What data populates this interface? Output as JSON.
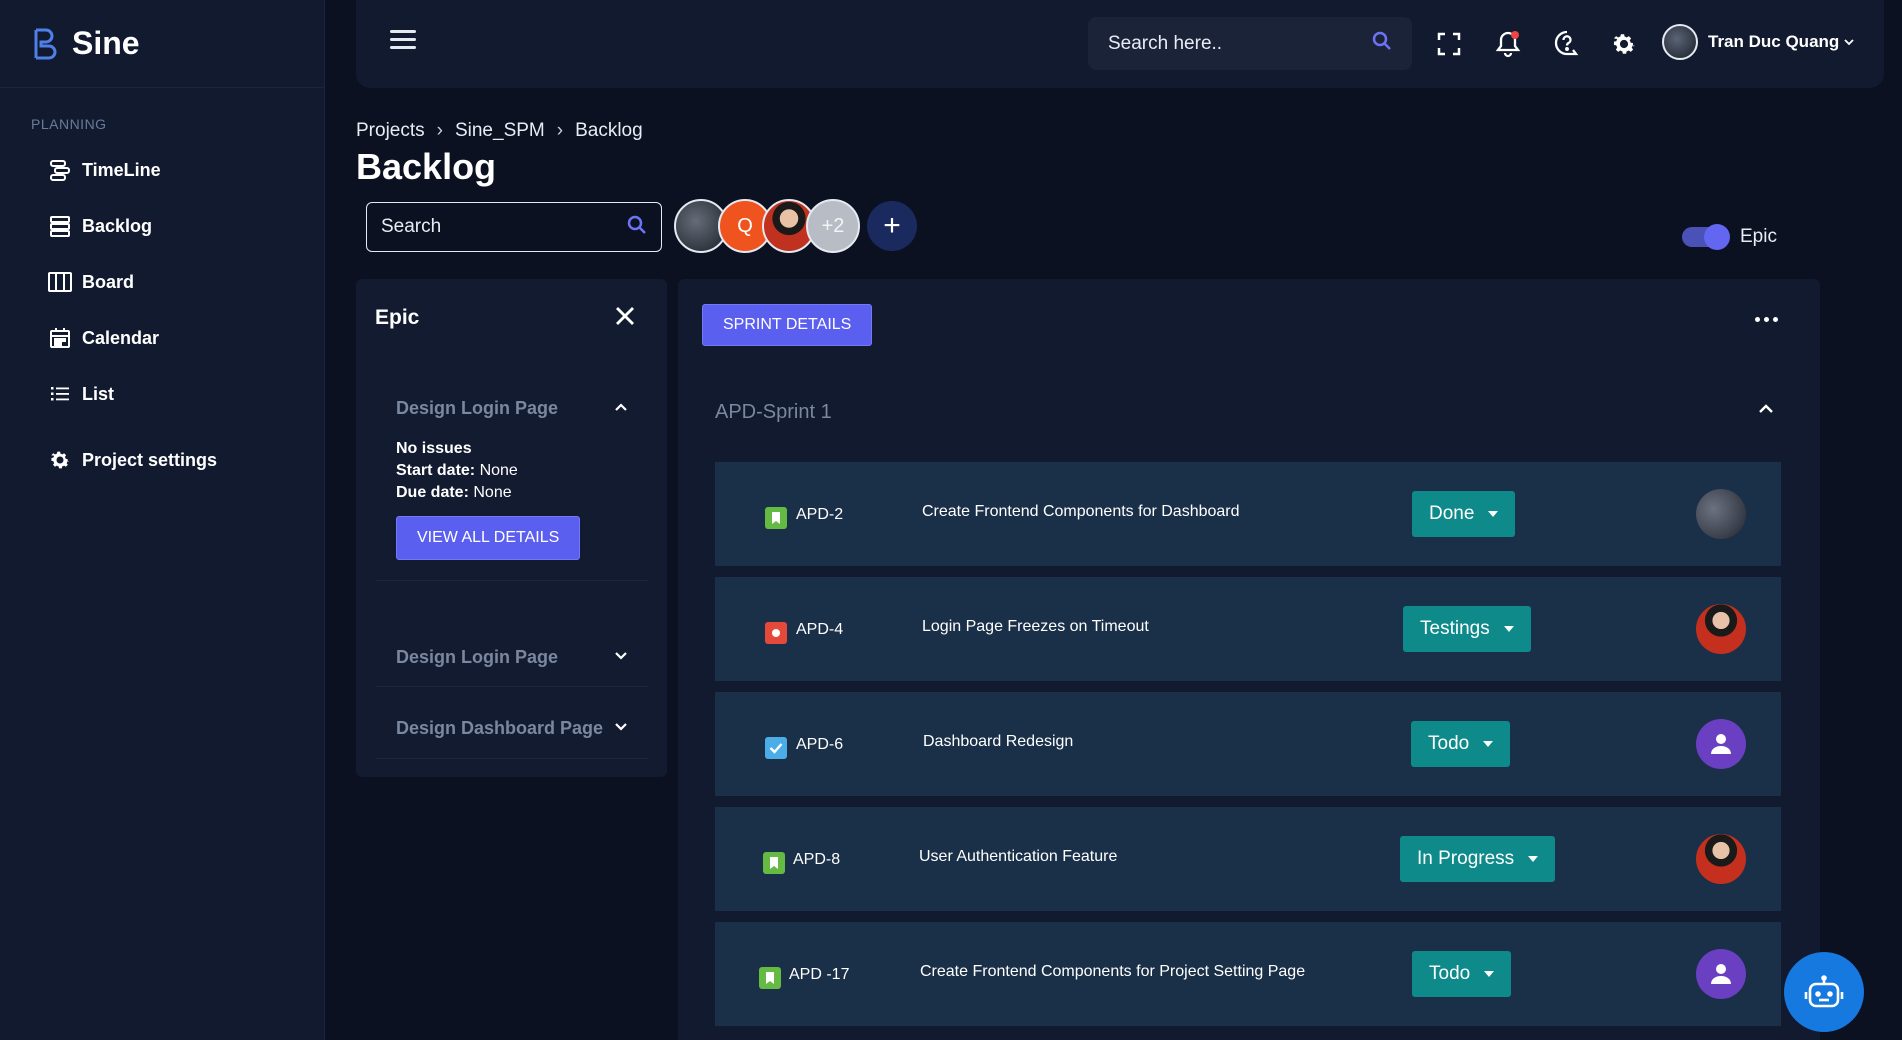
{
  "app": {
    "name": "Sine"
  },
  "sidebar": {
    "section": "PLANNING",
    "items": [
      {
        "label": "TimeLine",
        "icon": "timeline-icon"
      },
      {
        "label": "Backlog",
        "icon": "backlog-icon"
      },
      {
        "label": "Board",
        "icon": "board-icon"
      },
      {
        "label": "Calendar",
        "icon": "calendar-icon"
      },
      {
        "label": "List",
        "icon": "list-icon"
      }
    ],
    "settings": {
      "label": "Project settings",
      "icon": "gear-icon"
    }
  },
  "header": {
    "search_placeholder": "Search here..",
    "user_name": "Tran Duc Quang",
    "notification_dot_color": "#ef4444"
  },
  "breadcrumb": [
    "Projects",
    "Sine_SPM",
    "Backlog"
  ],
  "page_title": "Backlog",
  "backlog_search_placeholder": "Search",
  "members": {
    "initial": "Q",
    "extra": "+2",
    "add": "+"
  },
  "epic_toggle": {
    "label": "Epic",
    "on": true
  },
  "epic_panel": {
    "title": "Epic",
    "items": [
      {
        "name": "Design Login Page",
        "expanded": true,
        "issues_text": "No issues",
        "start_label": "Start date:",
        "start_value": "None",
        "due_label": "Due date:",
        "due_value": "None",
        "button": "VIEW ALL DETAILS"
      },
      {
        "name": "Design Login Page",
        "expanded": false
      },
      {
        "name": "Design Dashboard Page",
        "expanded": false
      }
    ]
  },
  "sprint": {
    "details_button": "SPRINT DETAILS",
    "name": "APD-Sprint 1",
    "issues": [
      {
        "key": "APD-2",
        "summary": "Create Frontend Components for Dashboard",
        "status": "Done",
        "type": "story",
        "assignee": "dark-avatar"
      },
      {
        "key": "APD-4",
        "summary": "Login Page Freezes on Timeout",
        "status": "Testings",
        "type": "bug",
        "assignee": "red-avatar"
      },
      {
        "key": "APD-6",
        "summary": "Dashboard Redesign",
        "status": "Todo",
        "type": "task",
        "assignee": "person-icon"
      },
      {
        "key": "APD-8",
        "summary": "User Authentication Feature",
        "status": "In Progress",
        "type": "story",
        "assignee": "red-avatar"
      },
      {
        "key": "APD -17",
        "summary": "Create Frontend Components for Project Setting Page",
        "status": "Todo",
        "type": "story",
        "assignee": "person-icon"
      }
    ]
  },
  "colors": {
    "accent": "#5b5ff0",
    "status": "#0e8a8a",
    "story": "#65ba43",
    "bug": "#e5493a",
    "task": "#4bade8"
  }
}
